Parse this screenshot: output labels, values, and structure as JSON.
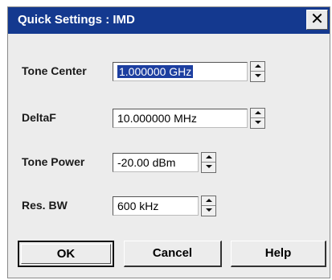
{
  "window": {
    "title": "Quick Settings : IMD",
    "close_label": "✕"
  },
  "fields": [
    {
      "label": "Tone Center",
      "value": "1.000000 GHz",
      "selected": true
    },
    {
      "label": "DeltaF",
      "value": "10.000000 MHz",
      "selected": false
    },
    {
      "label": "Tone Power",
      "value": "-20.00 dBm",
      "selected": false
    },
    {
      "label": "Res. BW",
      "value": "600 kHz",
      "selected": false
    }
  ],
  "buttons": {
    "ok": "OK",
    "cancel": "Cancel",
    "help": "Help"
  },
  "colors": {
    "titlebar": "#14398f",
    "selection": "#1d3fa0",
    "dialog_bg": "#ececec"
  }
}
